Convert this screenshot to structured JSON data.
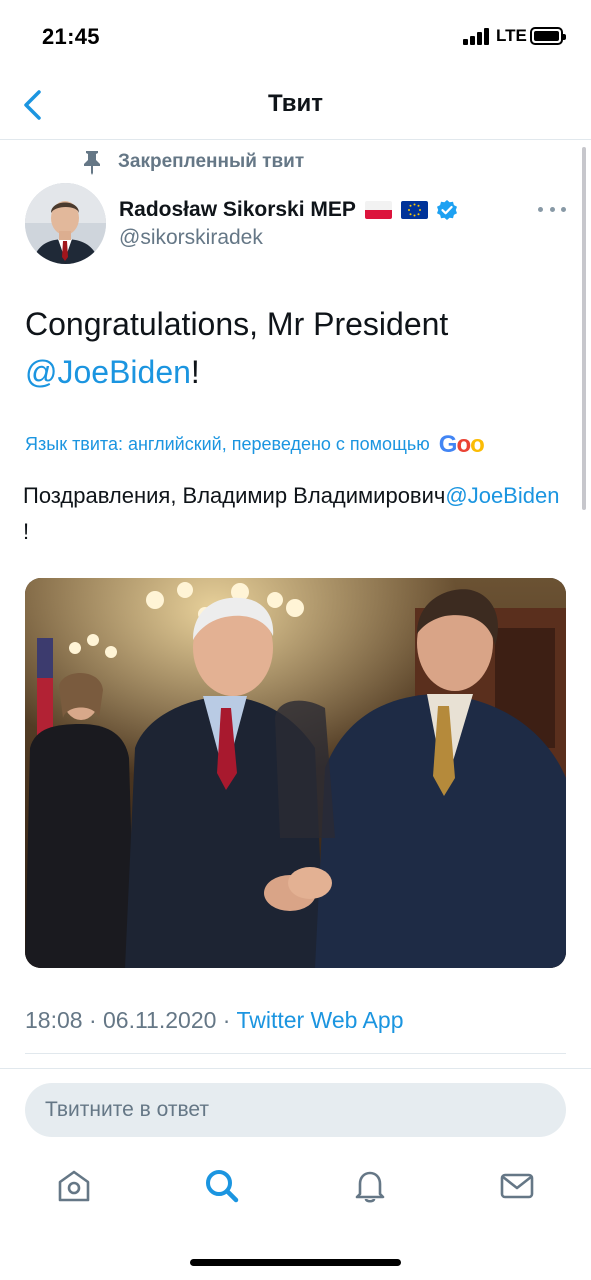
{
  "status_bar": {
    "time": "21:45",
    "network": "LTE"
  },
  "nav": {
    "title": "Твит",
    "back_icon": "chevron-left-icon"
  },
  "tweet": {
    "pinned_label": "Закрепленный твит",
    "author": {
      "name": "Radosław Sikorski MEP",
      "handle": "@sikorskiradek",
      "flags": [
        "poland-flag",
        "eu-flag"
      ],
      "verified": true
    },
    "text_before": "Congratulations, Mr President ",
    "mention": "@JoeBiden",
    "text_after": "!",
    "translation_label": "Язык твита: английский, переведено с помощью",
    "translation_brand": [
      "G",
      "o",
      "o"
    ],
    "translated_text_before": "Поздравления, Владимир Владимирович",
    "translated_mention": "@JoeBiden",
    "translated_text_after": " !",
    "media": "photo",
    "timestamp": "18:08 · 06.11.2020 · ",
    "source": "Twitter Web App"
  },
  "reply": {
    "placeholder": "Твитните в ответ"
  },
  "tab_bar": {
    "items": [
      "home-icon",
      "search-icon",
      "notifications-icon",
      "messages-icon"
    ],
    "active": "search-icon"
  },
  "colors": {
    "accent": "#1b95e0",
    "secondary_text": "#657786",
    "divider": "#e1e8ed"
  }
}
